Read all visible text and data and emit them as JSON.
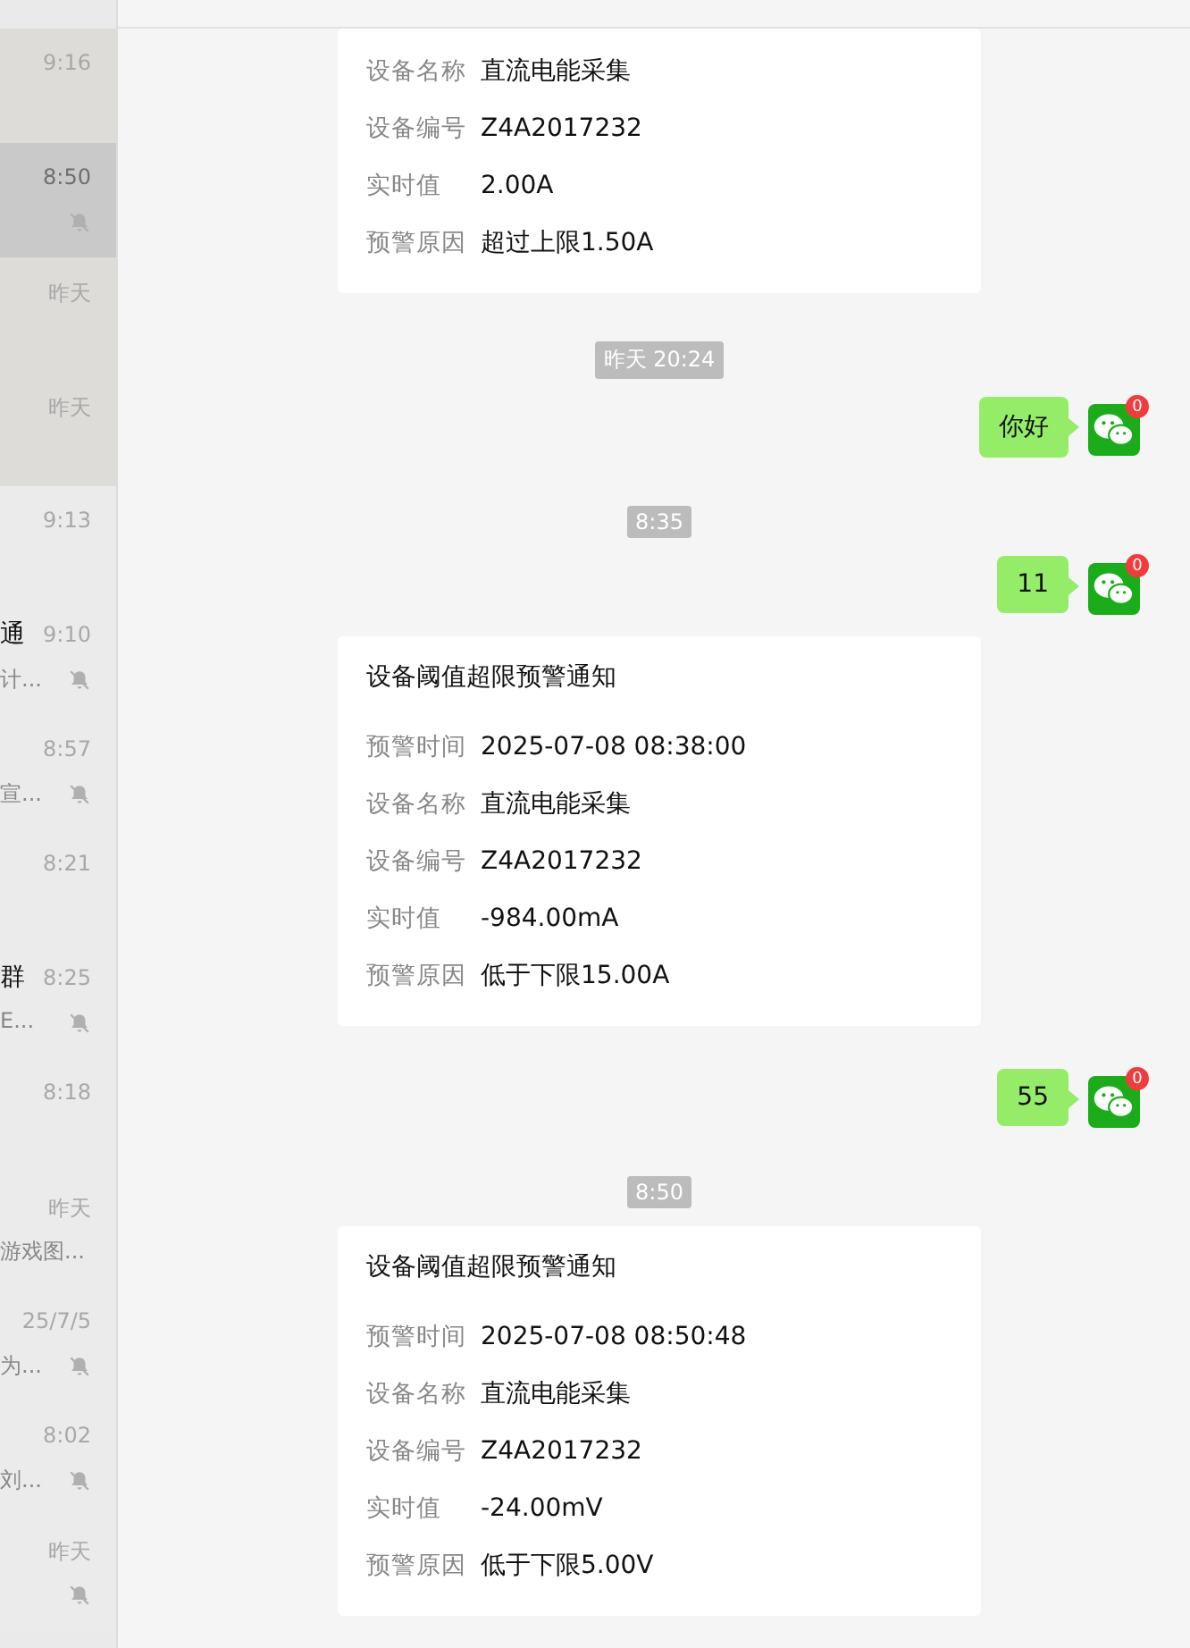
{
  "sidebar": {
    "items": [
      {
        "time": "9:16",
        "muted": false,
        "pinned": true,
        "selected": false
      },
      {
        "time": "8:50",
        "muted": true,
        "pinned": false,
        "selected": true
      },
      {
        "time": "昨天",
        "muted": false,
        "pinned": true,
        "selected": false
      },
      {
        "time": "昨天",
        "muted": false,
        "pinned": true,
        "selected": false
      },
      {
        "time": "9:13",
        "muted": false,
        "pinned": false,
        "selected": false
      },
      {
        "time": "9:10",
        "name": "通",
        "preview": "计...",
        "muted": true,
        "pinned": false,
        "selected": false
      },
      {
        "time": "8:57",
        "preview": "宣...",
        "muted": true,
        "pinned": false,
        "selected": false
      },
      {
        "time": "8:21",
        "muted": false,
        "pinned": false,
        "selected": false
      },
      {
        "time": "8:25",
        "name": "群",
        "preview": "E...",
        "muted": true,
        "pinned": false,
        "selected": false
      },
      {
        "time": "8:18",
        "muted": false,
        "pinned": false,
        "selected": false
      },
      {
        "time": "昨天",
        "preview": "游戏图...",
        "muted": false,
        "pinned": false,
        "selected": false
      },
      {
        "time": "25/7/5",
        "preview": "为...",
        "muted": true,
        "pinned": false,
        "selected": false
      },
      {
        "time": "8:02",
        "preview": "刘...",
        "muted": true,
        "pinned": false,
        "selected": false
      },
      {
        "time": "昨天",
        "muted": true,
        "pinned": false,
        "selected": false
      }
    ]
  },
  "messages": [
    {
      "kind": "card",
      "fields": [
        {
          "label": "设备名称",
          "value": "直流电能采集"
        },
        {
          "label": "设备编号",
          "value": "Z4A2017232"
        },
        {
          "label": "实时值",
          "value": "2.00A"
        },
        {
          "label": "预警原因",
          "value": "超过上限1.50A"
        }
      ]
    },
    {
      "kind": "time",
      "text": "昨天 20:24"
    },
    {
      "kind": "bubble",
      "text": "你好",
      "badge": "0"
    },
    {
      "kind": "time",
      "text": "8:35"
    },
    {
      "kind": "bubble",
      "text": "11",
      "badge": "0"
    },
    {
      "kind": "card",
      "title": "设备阈值超限预警通知",
      "fields": [
        {
          "label": "预警时间",
          "value": "2025-07-08 08:38:00"
        },
        {
          "label": "设备名称",
          "value": "直流电能采集"
        },
        {
          "label": "设备编号",
          "value": "Z4A2017232"
        },
        {
          "label": "实时值",
          "value": "-984.00mA"
        },
        {
          "label": "预警原因",
          "value": "低于下限15.00A"
        }
      ]
    },
    {
      "kind": "bubble",
      "text": "55",
      "badge": "0"
    },
    {
      "kind": "time",
      "text": "8:50"
    },
    {
      "kind": "card",
      "title": "设备阈值超限预警通知",
      "fields": [
        {
          "label": "预警时间",
          "value": "2025-07-08 08:50:48"
        },
        {
          "label": "设备名称",
          "value": "直流电能采集"
        },
        {
          "label": "设备编号",
          "value": "Z4A2017232"
        },
        {
          "label": "实时值",
          "value": "-24.00mV"
        },
        {
          "label": "预警原因",
          "value": "低于下限5.00V"
        }
      ]
    }
  ]
}
